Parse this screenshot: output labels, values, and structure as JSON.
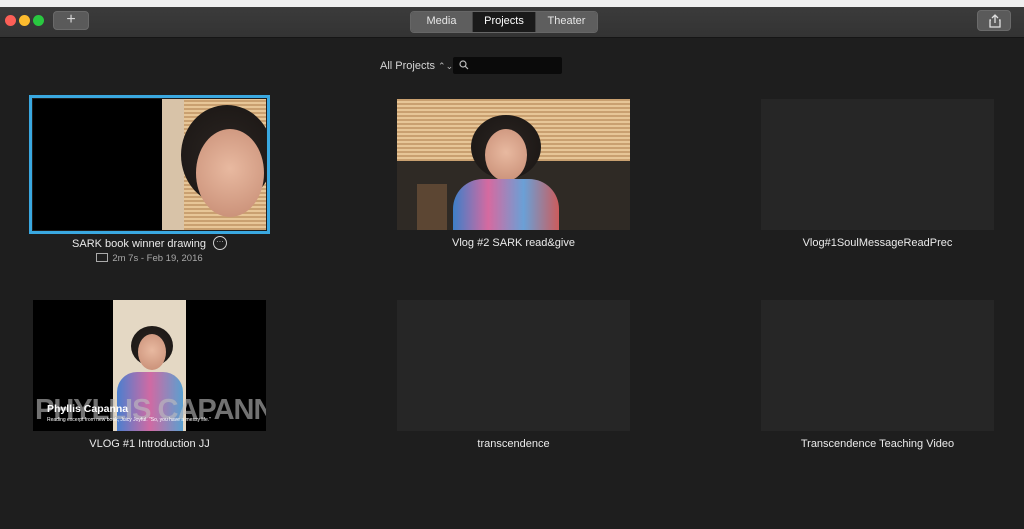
{
  "toolbar": {
    "add_label": "+",
    "tabs": [
      "Media",
      "Projects",
      "Theater"
    ],
    "active_tab": "Projects"
  },
  "filter": {
    "label": "All Projects",
    "search_placeholder": ""
  },
  "projects": [
    {
      "name": "SARK book winner drawing",
      "meta": "2m 7s - Feb 19, 2016",
      "selected": true
    },
    {
      "name": "Vlog #2 SARK read&give"
    },
    {
      "name": "Vlog#1SoulMessageReadPrec"
    },
    {
      "name": "VLOG #1 Introduction JJ",
      "overlay_title": "Phyllis Capanna",
      "overlay_subtitle": "Reading excerpt from new book, Juicy Joyful. \"So, you have a messy life.\"",
      "overlay_big": "PHYLLIS CAPANNA"
    },
    {
      "name": "transcendence"
    },
    {
      "name": "Transcendence Teaching Video"
    }
  ],
  "colors": {
    "selection": "#3aa8e0",
    "background": "#1e1e1e"
  }
}
